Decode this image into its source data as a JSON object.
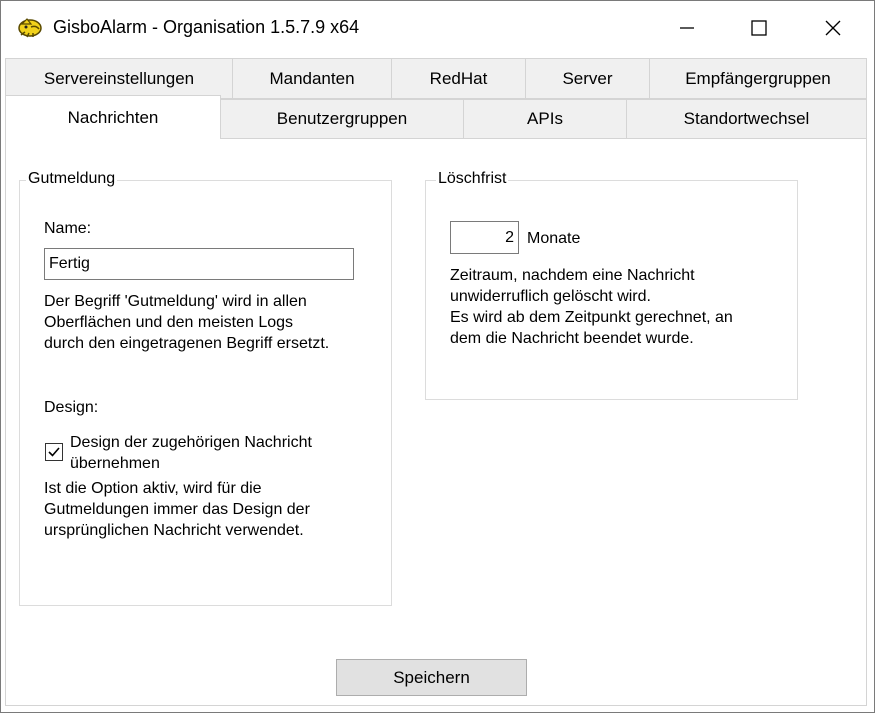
{
  "window": {
    "title": "GisboAlarm - Organisation 1.5.7.9 x64",
    "minimize_glyph": "—",
    "maximize_glyph": "☐",
    "close_glyph": "✕"
  },
  "tabs": {
    "row1": [
      "Servereinstellungen",
      "Mandanten",
      "RedHat",
      "Server",
      "Empfängergruppen"
    ],
    "row2": [
      "Nachrichten",
      "Benutzergruppen",
      "APIs",
      "Standortwechsel"
    ],
    "active": "Nachrichten"
  },
  "gutmeldung": {
    "group_label": "Gutmeldung",
    "name_label": "Name:",
    "name_value": "Fertig",
    "name_help": [
      "Der Begriff 'Gutmeldung' wird in allen",
      "Oberflächen und den meisten Logs",
      "durch den eingetragenen Begriff ersetzt."
    ],
    "design_label": "Design:",
    "checkbox_label": [
      "Design der zugehörigen Nachricht",
      "übernehmen"
    ],
    "checkbox_checked": true,
    "design_help": [
      "Ist die Option aktiv, wird für die",
      "Gutmeldungen immer das Design der",
      "ursprünglichen Nachricht verwendet."
    ]
  },
  "loeschfrist": {
    "group_label": "Löschfrist",
    "value": "2",
    "unit": "Monate",
    "help": [
      "Zeitraum, nachdem eine Nachricht",
      "unwiderruflich gelöscht wird.",
      "Es wird ab dem Zeitpunkt gerechnet, an",
      "dem die Nachricht beendet wurde."
    ]
  },
  "footer": {
    "save_label": "Speichern"
  }
}
